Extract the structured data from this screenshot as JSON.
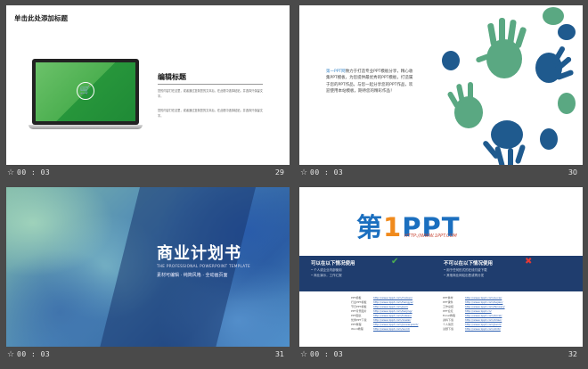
{
  "slides": [
    {
      "number": "29",
      "time": "00 : 03",
      "title": "单击此处添加标题",
      "heading": "编辑标题",
      "para1": "您的内容打在这里，或者通过复制您的文本后，在此框中选择粘贴，并选择只保留文字。",
      "para2": "您的内容打在这里，或者通过复制您的文本后，在此框中选择粘贴，并选择只保留文字。"
    },
    {
      "number": "30",
      "time": "00 : 03",
      "highlight": "第一PPT网",
      "body": "致力于打造专业PPT模板分享，精心收集PPT模板，为您提供最优秀的PPT模板，打造属于您的PPT作品，与您一起分享您的PPT作品，欢迎使用本站模板，期待您的精彩作品！"
    },
    {
      "number": "31",
      "time": "00 : 03",
      "title": "商业计划书",
      "subtitle": "THE PROFESSIONAL POWERPOINT TEMPLATE",
      "info": "素材可编辑 · 纯简风格 · 全动画页面"
    },
    {
      "number": "32",
      "time": "00 : 03",
      "logo_a": "第",
      "logo_b": "1",
      "logo_c": "PPT",
      "logo_url": "HTTP://WWW.1PPT.COM",
      "can_heading": "可以在以下情况使用",
      "can_lines": [
        "• 个人或企业内部使用",
        "• 商业演示，工作汇报"
      ],
      "cannot_heading": "不可以在以下情况使用",
      "cannot_lines": [
        "• 用于任何形式的在线付费下载",
        "• 其他商业网站出售或再分发"
      ],
      "links_left": {
        "labels": [
          "PPT模板",
          "行业PPT模板",
          "节日PPT模板",
          "PPT背景图片",
          "PPT图表",
          "优秀PPT下载",
          "PPT教程",
          "Word教程"
        ],
        "urls": [
          "http://www.1ppt.com/moban/",
          "http://www.1ppt.com/hangye/",
          "http://www.1ppt.com/jieri/",
          "http://www.1ppt.com/beijing/",
          "http://www.1ppt.com/tubiao/",
          "http://www.1ppt.com/xiazai/",
          "http://www.1ppt.com/powerpoint/",
          "http://www.1ppt.com/word/"
        ]
      },
      "links_right": {
        "labels": [
          "PPT素材",
          "PPT课件",
          "工作总结",
          "PPT论坛",
          "Excel教程",
          "资料下载",
          "个人简历",
          "试题下载"
        ],
        "urls": [
          "http://www.1ppt.com/sucai/",
          "http://www.1ppt.com/kejian/",
          "http://www.1ppt.com/fanwen/",
          "http://www.1ppt.cn/",
          "http://www.1ppt.com/excel/",
          "http://www.1ppt.com/ziliao/",
          "http://www.1ppt.com/jianli/",
          "http://www.1ppt.com/shiti/"
        ]
      }
    }
  ],
  "colors": {
    "hand_green": "#5aa882",
    "hand_blue": "#1f5a8e",
    "accent_blue": "#1b6fbf",
    "accent_orange": "#f08a1c",
    "band_navy": "#1f3d6e"
  }
}
